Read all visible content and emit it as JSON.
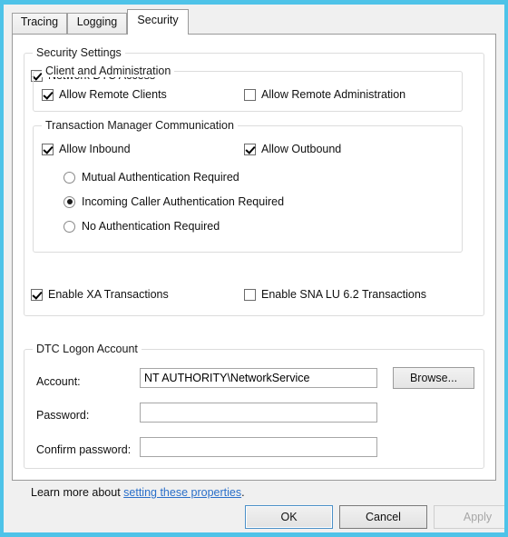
{
  "tabs": [
    {
      "label": "Tracing",
      "active": false
    },
    {
      "label": "Logging",
      "active": false
    },
    {
      "label": "Security",
      "active": true
    }
  ],
  "security_settings": {
    "title": "Security Settings",
    "network_dtc_access": {
      "label": "Network DTC Access",
      "checked": true
    },
    "client_admin": {
      "title": "Client and Administration",
      "allow_remote_clients": {
        "label": "Allow Remote Clients",
        "checked": true
      },
      "allow_remote_administration": {
        "label": "Allow Remote Administration",
        "checked": false
      }
    },
    "transaction_manager": {
      "title": "Transaction Manager Communication",
      "allow_inbound": {
        "label": "Allow Inbound",
        "checked": true
      },
      "allow_outbound": {
        "label": "Allow Outbound",
        "checked": true
      },
      "auth_options": [
        {
          "label": "Mutual Authentication Required",
          "selected": false
        },
        {
          "label": "Incoming Caller Authentication Required",
          "selected": true
        },
        {
          "label": "No Authentication Required",
          "selected": false
        }
      ]
    },
    "enable_xa": {
      "label": "Enable XA Transactions",
      "checked": true
    },
    "enable_sna": {
      "label": "Enable SNA LU 6.2 Transactions",
      "checked": false
    }
  },
  "logon_account": {
    "title": "DTC Logon Account",
    "account_label": "Account:",
    "account_value": "NT AUTHORITY\\NetworkService",
    "password_label": "Password:",
    "password_value": "",
    "confirm_label": "Confirm password:",
    "confirm_value": "",
    "browse_label": "Browse..."
  },
  "help": {
    "prefix": "Learn more about ",
    "link_text": "setting these properties",
    "suffix": "."
  },
  "buttons": {
    "ok": "OK",
    "cancel": "Cancel",
    "apply": "Apply"
  },
  "colors": {
    "window_border": "#4ec3e8",
    "dialog_face": "#f0f0f0",
    "page_face": "#ffffff",
    "link": "#2a6fc9",
    "focus_border": "#4a90c8",
    "disabled_text": "#a6a6a6"
  }
}
